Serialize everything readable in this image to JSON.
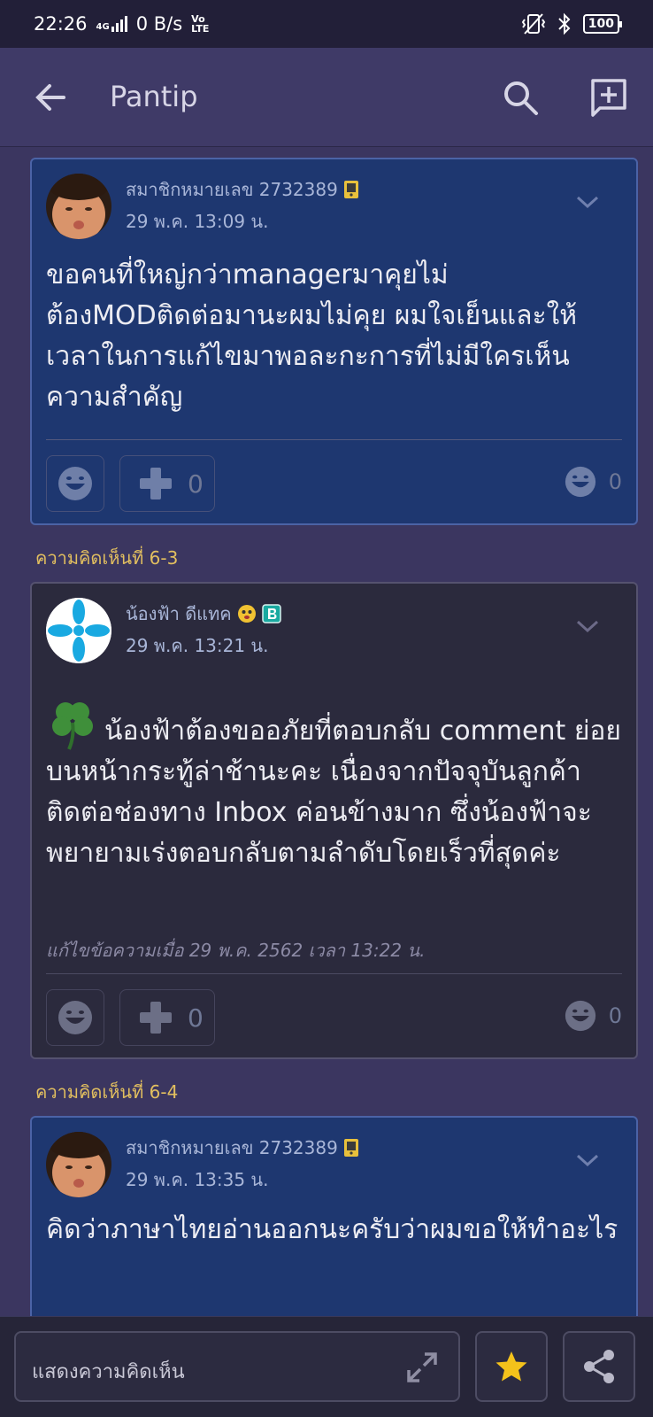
{
  "status_bar": {
    "time": "22:26",
    "network": "4G",
    "data_speed": "0 B/s",
    "volte_top": "Vo",
    "volte_bottom": "LTE",
    "battery": "100"
  },
  "app_bar": {
    "title": "Pantip"
  },
  "comments": [
    {
      "author": "สมาชิกหมายเลข 2732389",
      "date": "29 พ.ค. 13:09 น.",
      "body": "ขอคนที่ใหญ่กว่าmanagerมาคุยไม่ต้องMODติดต่อมานะผมไม่คุย ผมใจเย็นและให้เวลาในการแก้ไขมาพอละกะการที่ไม่มีใครเห็นความสำคัญ",
      "plus_count": "0",
      "reaction_count": "0"
    },
    {
      "section_label": "ความคิดเห็นที่ 6-3",
      "author": "น้องฟ้า ดีแทค",
      "date": "29 พ.ค. 13:21 น.",
      "body": "น้องฟ้าต้องขออภัยที่ตอบกลับ comment ย่อยบนหน้ากระทู้ล่าช้านะคะ เนื่องจากปัจจุบันลูกค้าติดต่อช่องทาง Inbox ค่อนข้างมาก ซึ่งน้องฟ้าจะพยายามเร่งตอบกลับตามลำดับโดยเร็วที่สุดค่ะ",
      "edited": "แก้ไขข้อความเมื่อ 29 พ.ค. 2562 เวลา  13:22 น.",
      "plus_count": "0",
      "reaction_count": "0"
    },
    {
      "section_label": "ความคิดเห็นที่ 6-4",
      "author": "สมาชิกหมายเลข 2732389",
      "date": "29 พ.ค. 13:35 น.",
      "body": "คิดว่าภาษาไทยอ่านออกนะครับว่าผมขอให้ทำอะไร"
    }
  ],
  "bottom_bar": {
    "comment_placeholder": "แสดงความคิดเห็น"
  },
  "colors": {
    "accent_gold": "#e2bf5f",
    "card_blue": "#1e3770",
    "card_dark": "#2b2a3d",
    "background": "#3b3660"
  }
}
